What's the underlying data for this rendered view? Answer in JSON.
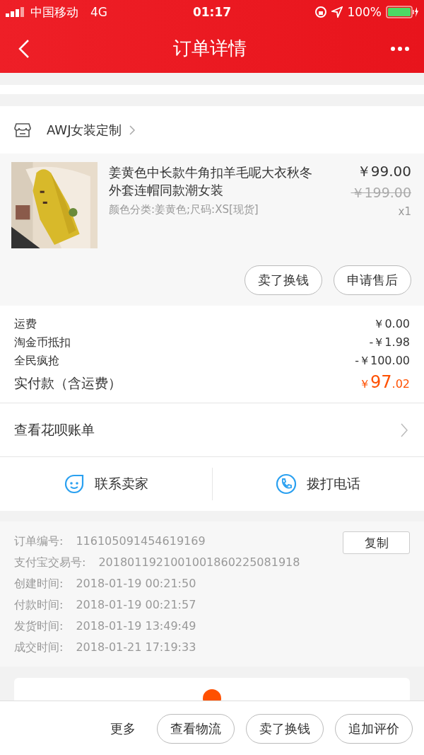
{
  "status_bar": {
    "carrier": "中国移动",
    "network": "4G",
    "time": "01:17",
    "battery": "100%"
  },
  "nav": {
    "title": "订单详情"
  },
  "shop": {
    "name": "AWJ女装定制"
  },
  "product": {
    "kind": "picture",
    "title": "姜黄色中长款牛角扣羊毛呢大衣秋冬外套连帽同款潮女装",
    "spec": "颜色分类:姜黄色;尺码:XS[现货]",
    "price": "￥99.00",
    "original_price": "￥199.00",
    "quantity": "x1",
    "actions": [
      "卖了换钱",
      "申请售后"
    ]
  },
  "fees": [
    {
      "label": "运费",
      "value": "￥0.00"
    },
    {
      "label": "淘金币抵扣",
      "value": "-￥1.98"
    },
    {
      "label": "全民疯抢",
      "value": "-￥100.00"
    }
  ],
  "total": {
    "label": "实付款（含运费）",
    "currency": "￥",
    "integer": "97",
    "decimal": ".02"
  },
  "huabei": {
    "label": "查看花呗账单"
  },
  "contact": [
    {
      "kind": "chat",
      "label": "联系卖家"
    },
    {
      "kind": "phone",
      "label": "拨打电话"
    }
  ],
  "order_info": {
    "copy_button": "复制",
    "rows": [
      {
        "label": "订单编号:",
        "value": "116105091454619169"
      },
      {
        "label": "支付宝交易号:",
        "value": "2018011921001001860225081918"
      },
      {
        "label": "创建时间:",
        "value": "2018-01-19 00:21:50"
      },
      {
        "label": "付款时间:",
        "value": "2018-01-19 00:21:57"
      },
      {
        "label": "发货时间:",
        "value": "2018-01-19 13:49:49"
      },
      {
        "label": "成交时间:",
        "value": "2018-01-21 17:19:33"
      }
    ]
  },
  "bottom_bar": {
    "more": "更多",
    "buttons": [
      "查看物流",
      "卖了换钱",
      "追加评价"
    ]
  }
}
